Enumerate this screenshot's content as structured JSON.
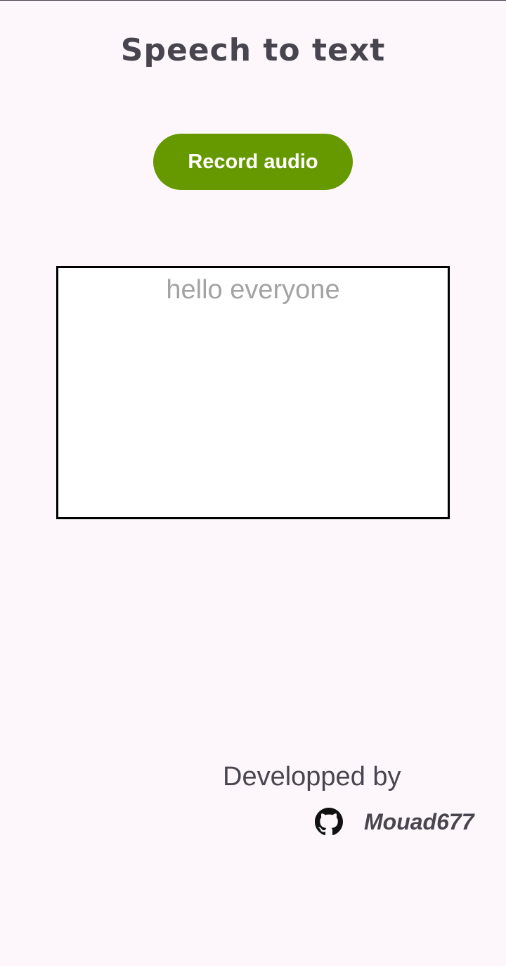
{
  "app": {
    "title": "Speech to text"
  },
  "actions": {
    "record_label": "Record audio"
  },
  "output": {
    "text": "hello everyone"
  },
  "footer": {
    "developed_by": "Developped by",
    "author": "Mouad677",
    "icon": "github-icon"
  },
  "colors": {
    "background": "#fdf7fc",
    "button": "#669900",
    "title_text": "#49454f",
    "output_text": "#a3a3a3"
  }
}
